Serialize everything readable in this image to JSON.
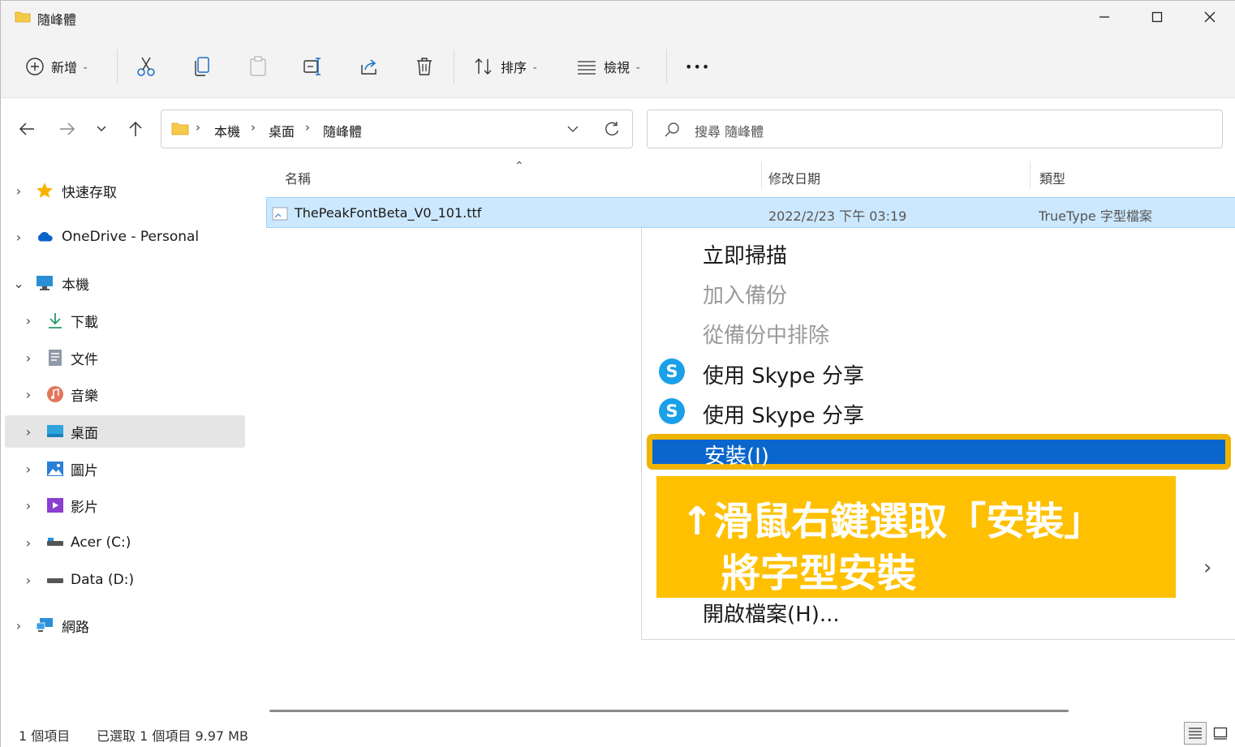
{
  "window": {
    "title": "隨峰體"
  },
  "toolbar": {
    "new_label": "新增",
    "sort_label": "排序",
    "view_label": "檢視",
    "more_label": "•••"
  },
  "address": {
    "crumbs": [
      "本機",
      "桌面",
      "隨峰體"
    ],
    "search_placeholder": "搜尋 隨峰體"
  },
  "sidebar": {
    "items": [
      {
        "label": "快速存取"
      },
      {
        "label": "OneDrive - Personal"
      },
      {
        "label": "本機"
      },
      {
        "label": "下載"
      },
      {
        "label": "文件"
      },
      {
        "label": "音樂"
      },
      {
        "label": "桌面"
      },
      {
        "label": "圖片"
      },
      {
        "label": "影片"
      },
      {
        "label": "Acer (C:)"
      },
      {
        "label": "Data (D:)"
      },
      {
        "label": "網路"
      }
    ]
  },
  "columns": {
    "name": "名稱",
    "modified": "修改日期",
    "type": "類型"
  },
  "file": {
    "name": "ThePeakFontBeta_V0_101.ttf",
    "modified": "2022/2/23 下午 03:19",
    "type": "TrueType 字型檔案"
  },
  "context_menu": {
    "items": [
      {
        "label": "立即掃描"
      },
      {
        "label": "加入備份"
      },
      {
        "label": "從備份中排除"
      },
      {
        "label": "使用 Skype 分享"
      },
      {
        "label": "使用 Skype 分享"
      },
      {
        "label": "安裝(I)"
      },
      {
        "label": "開啟檔案(H)..."
      }
    ]
  },
  "callout": {
    "line1": "↑滑鼠右鍵選取「安裝」",
    "line2": "將字型安裝",
    "color": "#FEC000"
  },
  "status": {
    "count": "1 個項目",
    "selected": "已選取 1 個項目  9.97 MB"
  },
  "colors": {
    "highlight": "#0A66CC",
    "selection": "#CCE8FF",
    "outline": "#F0B400"
  }
}
